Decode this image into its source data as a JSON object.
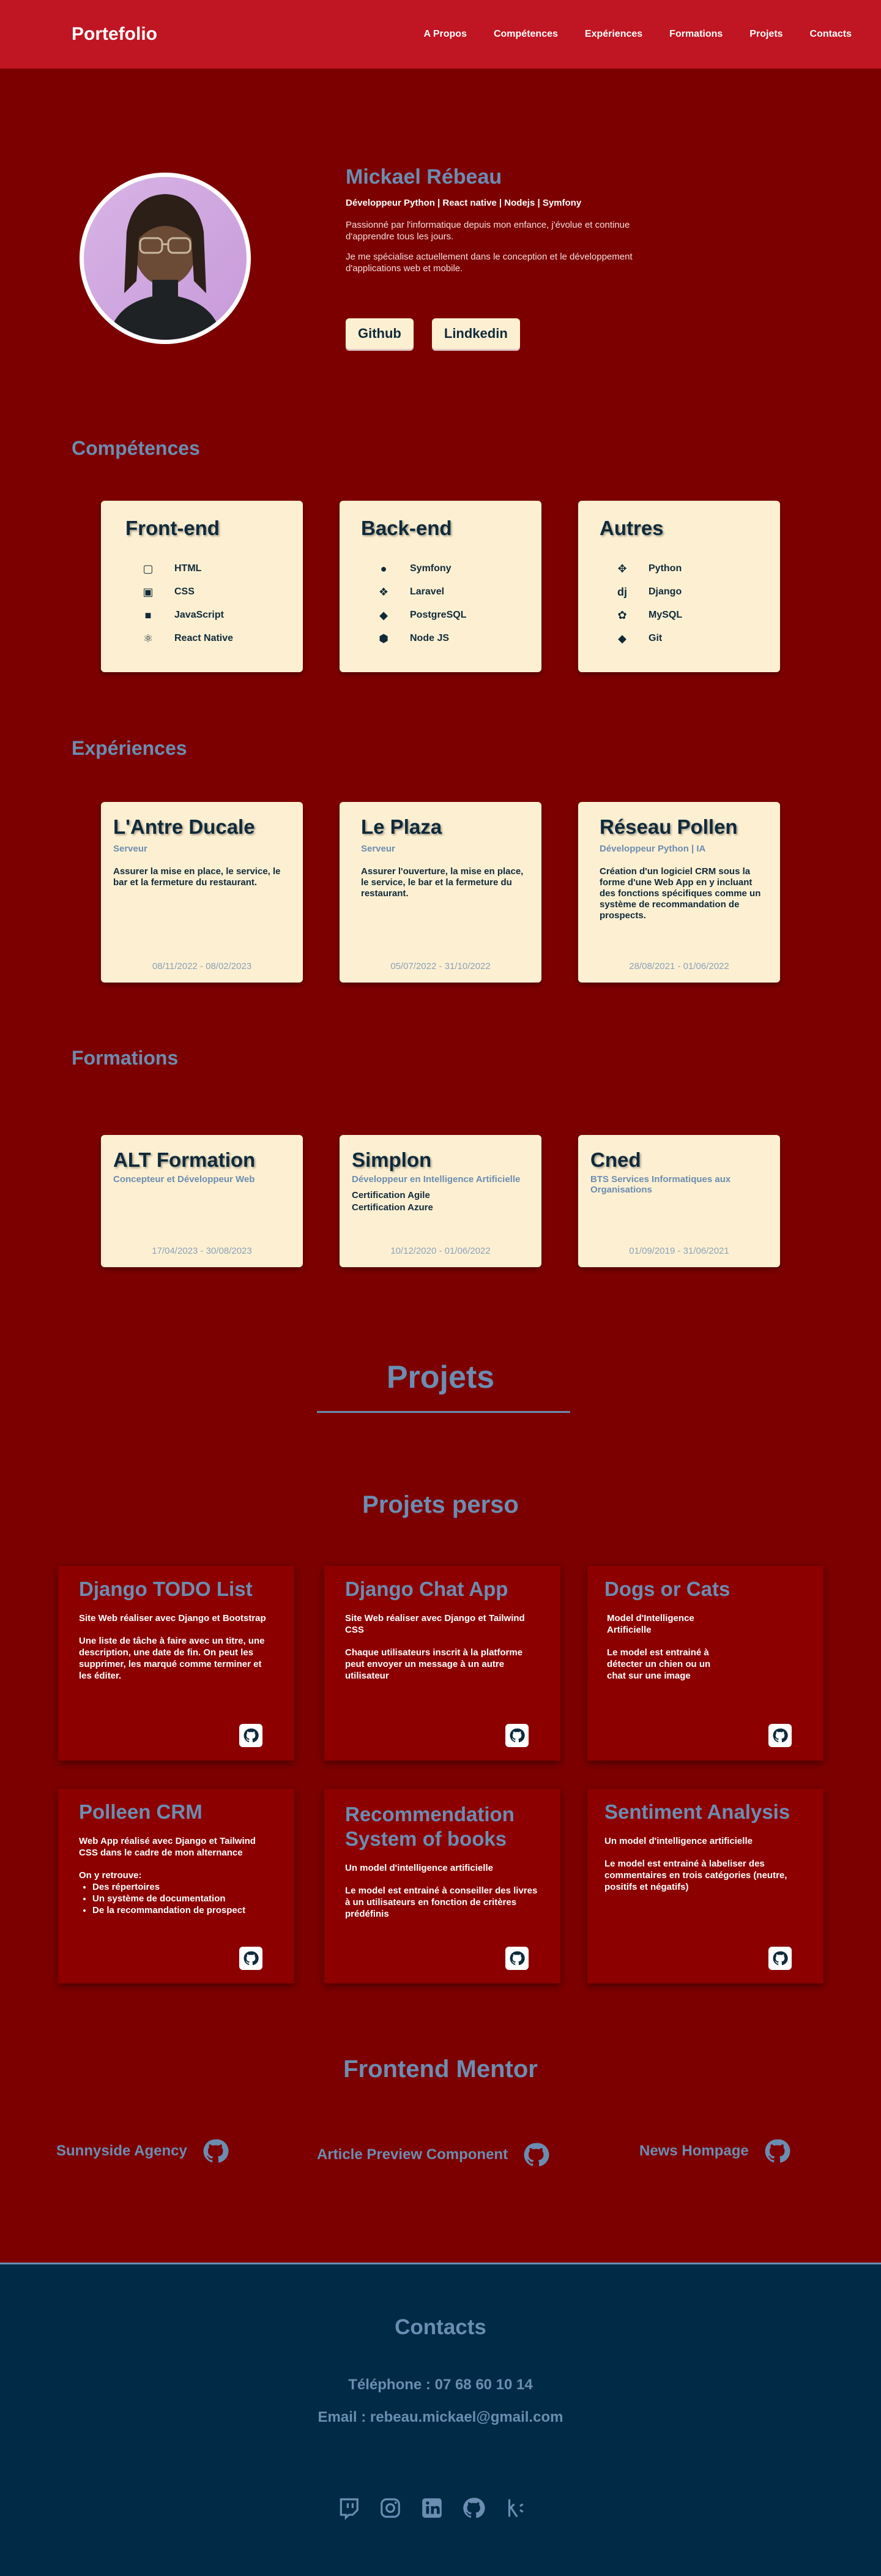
{
  "nav": {
    "brand": "Portefolio",
    "links": [
      "A Propos",
      "Compétences",
      "Expériences",
      "Formations",
      "Projets",
      "Contacts"
    ]
  },
  "hero": {
    "name": "Mickael Rébeau",
    "role": "Développeur Python | React native | Nodejs | Symfony",
    "p1": "Passionné par l'informatique depuis mon enfance, j'évolue et continue d'apprendre tous les jours.",
    "p2": "Je me spécialise actuellement dans le conception et le développement d'applications web et mobile.",
    "github_label": "Github",
    "linkedin_label": "Lindkedin"
  },
  "skills": {
    "title": "Compétences",
    "cards": [
      {
        "title": "Front-end",
        "items": [
          {
            "label": "HTML",
            "icon": "html5-icon"
          },
          {
            "label": "CSS",
            "icon": "css3-icon"
          },
          {
            "label": "JavaScript",
            "icon": "javascript-icon"
          },
          {
            "label": "React Native",
            "icon": "react-icon"
          }
        ]
      },
      {
        "title": "Back-end",
        "items": [
          {
            "label": "Symfony",
            "icon": "symfony-icon"
          },
          {
            "label": "Laravel",
            "icon": "laravel-icon"
          },
          {
            "label": "PostgreSQL",
            "icon": "postgresql-icon"
          },
          {
            "label": "Node JS",
            "icon": "nodejs-icon"
          }
        ]
      },
      {
        "title": "Autres",
        "items": [
          {
            "label": "Python",
            "icon": "python-icon"
          },
          {
            "label": "Django",
            "icon": "django-icon"
          },
          {
            "label": "MySQL",
            "icon": "mysql-icon"
          },
          {
            "label": "Git",
            "icon": "git-icon"
          }
        ]
      }
    ]
  },
  "experiences": {
    "title": "Expériences",
    "cards": [
      {
        "title": "L'Antre Ducale",
        "sub": "Serveur",
        "desc": "Assurer la mise en place, le service, le bar et la fermeture du restaurant.",
        "dates": "08/11/2022 - 08/02/2023"
      },
      {
        "title": "Le Plaza",
        "sub": "Serveur",
        "desc": "Assurer l'ouverture, la mise en place, le service, le bar et la fermeture du restaurant.",
        "dates": "05/07/2022 - 31/10/2022"
      },
      {
        "title": "Réseau Pollen",
        "sub": "Développeur Python | IA",
        "desc": "Création d'un logiciel CRM sous la forme d'une Web App en y incluant des fonctions spécifiques comme un système de recommandation de prospects.",
        "dates": "28/08/2021 - 01/06/2022"
      }
    ]
  },
  "formations": {
    "title": "Formations",
    "cards": [
      {
        "title": "ALT Formation",
        "sub": "Concepteur et Développeur Web",
        "certs": [],
        "dates": "17/04/2023 - 30/08/2023"
      },
      {
        "title": "Simplon",
        "sub": "Développeur en Intelligence Artificielle",
        "certs": [
          "Certification Agile",
          "Certification Azure"
        ],
        "dates": "10/12/2020 - 01/06/2022"
      },
      {
        "title": "Cned",
        "sub": "BTS Services Informatiques aux Organisations",
        "certs": [],
        "dates": "01/09/2019 - 31/06/2021"
      }
    ]
  },
  "projets": {
    "title": "Projets",
    "perso_title": "Projets perso",
    "cards": [
      {
        "title": "Django TODO List",
        "summary": "Site Web réaliser avec Django et Bootstrap",
        "desc": "Une liste de tâche à faire avec un titre, une description, une date de fin. On peut les supprimer, les marqué comme terminer et les éditer."
      },
      {
        "title": "Django Chat App",
        "summary": "Site Web réaliser avec Django et Tailwind CSS",
        "desc": "Chaque utilisateurs inscrit à la platforme peut envoyer un message à un autre utilisateur"
      },
      {
        "title": "Dogs or Cats",
        "summary": "Model d'Intelligence Artificielle",
        "desc": "Le model est entrainé à détecter un chien ou un chat sur une image"
      },
      {
        "title": "Polleen CRM",
        "summary": "Web App réalisé avec Django et Tailwind CSS dans le cadre de mon alternance",
        "desc": "On y retrouve:",
        "list": [
          "Des répertoires",
          "Un système de documentation",
          "De la recommandation de prospect"
        ]
      },
      {
        "title": "Recommendation System of books",
        "summary": "Un model d'intelligence artificielle",
        "desc": "Le model est entrainé à conseiller des livres à un utilisateurs en fonction de critères prédéfinis"
      },
      {
        "title": "Sentiment Analysis",
        "summary": "Un model d'intelligence artificielle",
        "desc": "Le model est entrainé à labeliser des commentaires en trois catégories (neutre, positifs et négatifs)"
      }
    ]
  },
  "frontend_mentor": {
    "title": "Frontend Mentor",
    "items": [
      "Sunnyside Agency",
      "Article Preview Component",
      "News Hompage"
    ]
  },
  "contacts": {
    "title": "Contacts",
    "phone": "Téléphone : 07 68 60 10 14",
    "email": "Email : rebeau.mickael@gmail.com",
    "socials": [
      "twitch-icon",
      "instagram-icon",
      "linkedin-icon",
      "github-icon",
      "kaggle-icon"
    ]
  },
  "colors": {
    "background": "#7c0000",
    "navbar": "#c01522",
    "accent": "#6b8db1",
    "card": "#fdf0d2",
    "footer": "#002a45"
  }
}
